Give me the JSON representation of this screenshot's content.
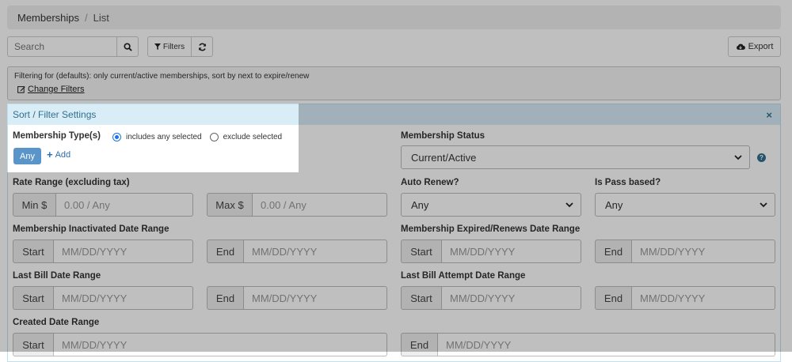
{
  "breadcrumb": {
    "root": "Memberships",
    "separator": "/",
    "current": "List"
  },
  "toolbar": {
    "search_placeholder": "Search",
    "filters_label": "Filters",
    "export_label": "Export"
  },
  "filter_summary": {
    "text": "Filtering for (defaults): only current/active memberships, sort by next to expire/renew",
    "change_label": "Change Filters"
  },
  "panel": {
    "title": "Sort / Filter Settings",
    "close_glyph": "×",
    "membership_type": {
      "label": "Membership Type(s)",
      "option_includes": "includes any selected",
      "option_exclude": "exclude selected",
      "any_label": "Any",
      "add_label": "Add"
    },
    "membership_status": {
      "label": "Membership Status",
      "value": "Current/Active"
    },
    "rate_range": {
      "label": "Rate Range (excluding tax)",
      "min_addon": "Min $",
      "min_placeholder": "0.00 / Any",
      "max_addon": "Max $",
      "max_placeholder": "0.00 / Any"
    },
    "auto_renew": {
      "label": "Auto Renew?",
      "value": "Any"
    },
    "is_pass_based": {
      "label": "Is Pass based?",
      "value": "Any"
    },
    "inactivated_range": {
      "label": "Membership Inactivated Date Range"
    },
    "expired_range": {
      "label": "Membership Expired/Renews Date Range"
    },
    "last_bill_range": {
      "label": "Last Bill Date Range"
    },
    "last_bill_attempt_range": {
      "label": "Last Bill Attempt Date Range"
    },
    "created_range": {
      "label": "Created Date Range"
    },
    "start_addon": "Start",
    "end_addon": "End",
    "date_placeholder": "MM/DD/YYYY"
  },
  "colors": {
    "panel_header": "#d9edf7",
    "any_button": "#5a95c9",
    "link": "#2a6eb0"
  }
}
